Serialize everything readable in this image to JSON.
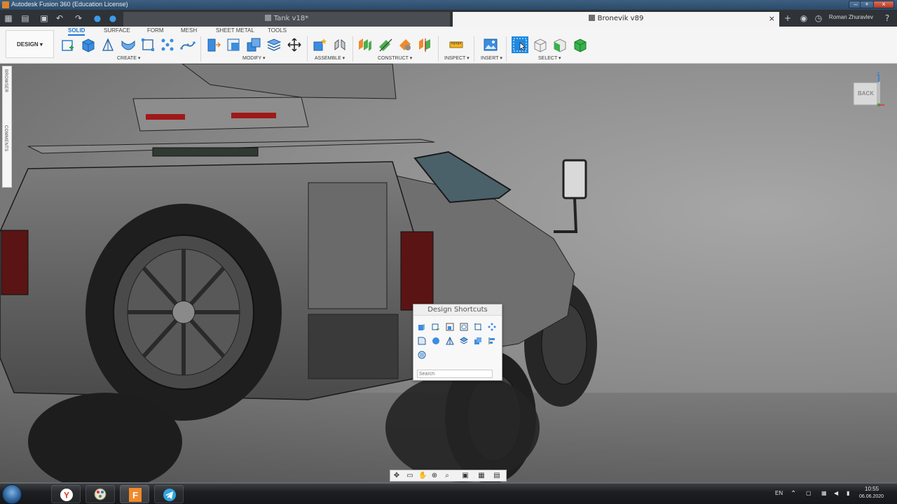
{
  "window": {
    "title": "Autodesk Fusion 360 (Education License)",
    "controls": [
      "–",
      "+",
      "×"
    ]
  },
  "tabs": [
    {
      "label": "Tank v18*",
      "active": false
    },
    {
      "label": "Bronevik v89",
      "active": true
    }
  ],
  "tab_close": "×",
  "user": {
    "name": "Roman Zhuravlev"
  },
  "toolbar": {
    "workspace_button": "DESIGN ▾",
    "workspace_tabs": [
      "SOLID",
      "SURFACE",
      "FORM",
      "MESH",
      "SHEET METAL",
      "TOOLS"
    ],
    "active_tab": "SOLID",
    "groups": [
      "CREATE ▾",
      "MODIFY ▾",
      "ASSEMBLE ▾",
      "CONSTRUCT ▾",
      "INSPECT ▾",
      "INSERT ▾",
      "SELECT ▾"
    ]
  },
  "side_panel": {
    "browser": "BROWSER",
    "comments": "COMMENTS"
  },
  "viewcube": {
    "face": "BACK",
    "axis": "Z"
  },
  "shortcuts": {
    "title": "Design Shortcuts",
    "search_placeholder": "Search"
  },
  "taskbar": {
    "language": "EN",
    "time": "10:55",
    "date": "06.06.2020"
  },
  "colors": {
    "accent": "#1f76d2",
    "titlebar": "#2c4a68",
    "tabbar": "#2f3236",
    "toolbar": "#f5f5f5"
  }
}
